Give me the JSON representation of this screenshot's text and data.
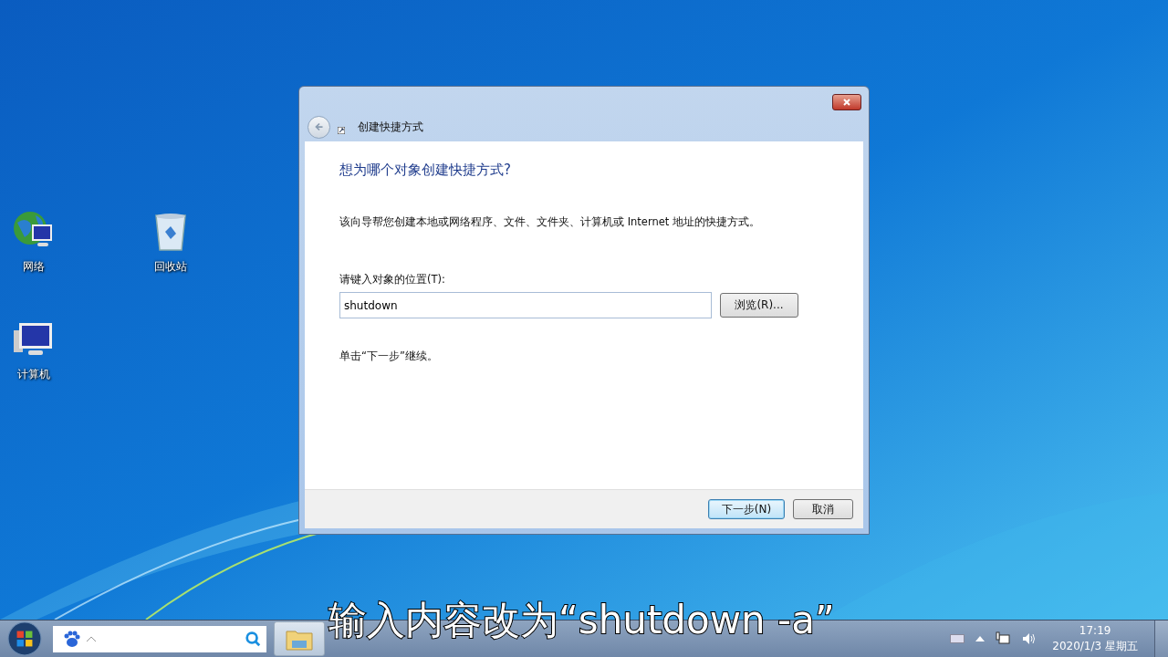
{
  "desktop_icons": [
    {
      "label": "网络",
      "kind": "network"
    },
    {
      "label": "回收站",
      "kind": "recycle"
    },
    {
      "label": "计算机",
      "kind": "computer"
    }
  ],
  "dialog": {
    "title": "创建快捷方式",
    "heading": "想为哪个对象创建快捷方式?",
    "description": "该向导帮您创建本地或网络程序、文件、文件夹、计算机或 Internet 地址的快捷方式。",
    "field_label": "请键入对象的位置(T):",
    "field_value": "shutdown",
    "browse_button": "浏览(R)...",
    "hint": "单击“下一步”继续。",
    "buttons": [
      {
        "label": "下一步(N)",
        "default": true
      },
      {
        "label": "取消",
        "default": false
      }
    ]
  },
  "taskbar": {
    "time": "17:19",
    "date": "2020/1/3 星期五"
  },
  "caption": "输入内容改为“shutdown -a”"
}
